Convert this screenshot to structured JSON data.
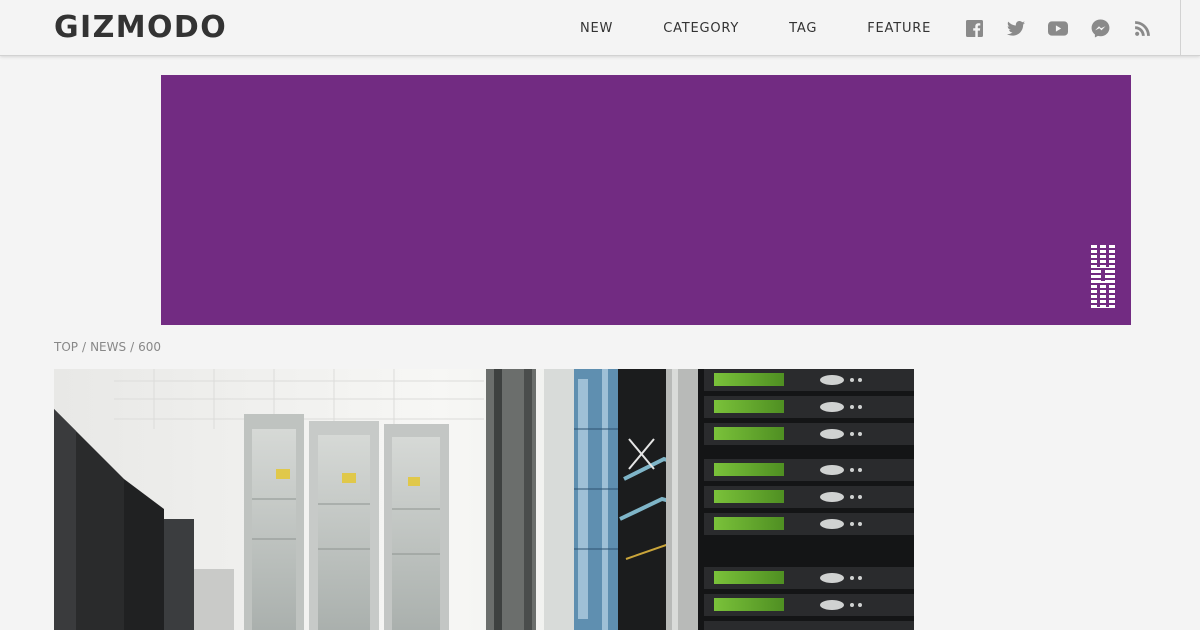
{
  "header": {
    "logo": "GIZMODO",
    "nav": [
      {
        "label": "NEW"
      },
      {
        "label": "CATEGORY"
      },
      {
        "label": "TAG"
      },
      {
        "label": "FEATURE"
      }
    ],
    "social": [
      "facebook-icon",
      "twitter-icon",
      "youtube-icon",
      "messenger-icon",
      "rss-icon"
    ],
    "icon_color": "#8a8a8a"
  },
  "ad": {
    "background": "#722b82",
    "brand_logo": "ibm-logo"
  },
  "breadcrumb": {
    "items": [
      {
        "label": "TOP"
      },
      {
        "label": "NEWS"
      },
      {
        "label": "600"
      }
    ],
    "separator": "/"
  },
  "hero": {
    "subject": "server-racks-photo"
  }
}
